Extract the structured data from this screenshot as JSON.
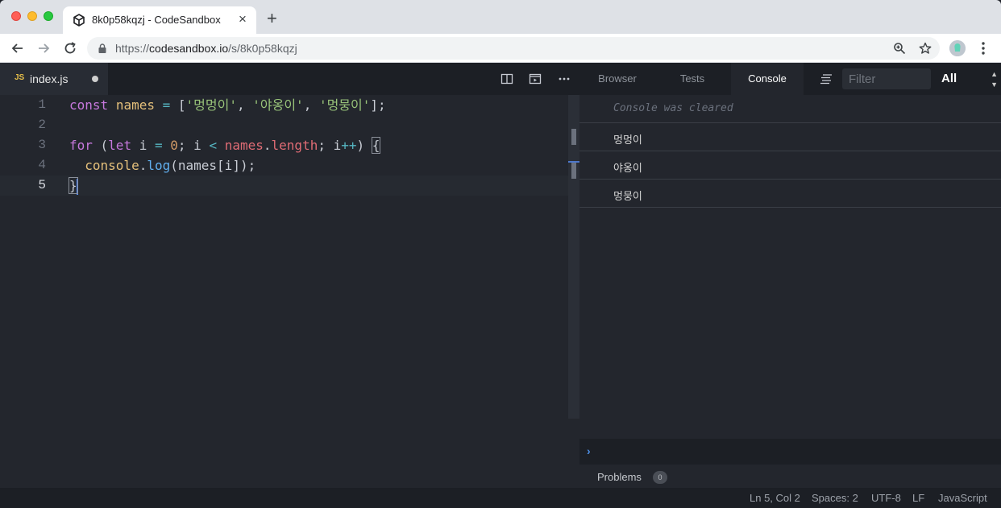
{
  "browser": {
    "tab_title": "8k0p58kqzj - CodeSandbox",
    "tab_close": "×",
    "new_tab": "+",
    "url_scheme": "https://",
    "url_host": "codesandbox.io",
    "url_path": "/s/8k0p58kqzj"
  },
  "editor": {
    "file_badge": "JS",
    "file_name": "index.js",
    "lines": [
      {
        "number": "1"
      },
      {
        "number": "2"
      },
      {
        "number": "3"
      },
      {
        "number": "4"
      },
      {
        "number": "5"
      }
    ],
    "tokens": {
      "const": "const",
      "names": "names",
      "eq": "=",
      "open_bracket": "[",
      "s1": "'멍멍이'",
      "comma1": ", ",
      "s2": "'야옹이'",
      "comma2": ", ",
      "s3": "'멍뭉이'",
      "close_bracket": "];",
      "for": "for",
      "paren_open": " (",
      "let": "let",
      "i": " i ",
      "zero": "0",
      "semi1": "; i ",
      "lt": "<",
      "names2": "names",
      "dot": ".",
      "length": "length",
      "semi2": "; i",
      "inc": "++",
      "paren_close": ") ",
      "brace_open": "{",
      "indent": "  ",
      "console": "console",
      "dot2": ".",
      "log": "log",
      "args": "(names[i]);",
      "brace_close": "}"
    }
  },
  "panel": {
    "tabs": [
      "Browser",
      "Tests",
      "Console"
    ],
    "active_tab": "Console",
    "filter_placeholder": "Filter",
    "level": "All",
    "cleared_message": "Console was cleared",
    "logs": [
      "멍멍이",
      "야옹이",
      "멍뭉이"
    ],
    "prompt": "›",
    "problems_label": "Problems",
    "problems_count": "0"
  },
  "status": {
    "position": "Ln 5, Col 2",
    "spaces": "Spaces: 2",
    "encoding": "UTF-8",
    "eol": "LF",
    "language": "JavaScript"
  },
  "colors": {
    "keyword": "#c678dd",
    "variable": "#e06c75",
    "string": "#98c379",
    "number": "#d19a66",
    "operator": "#56b6c2",
    "function": "#61afef"
  }
}
